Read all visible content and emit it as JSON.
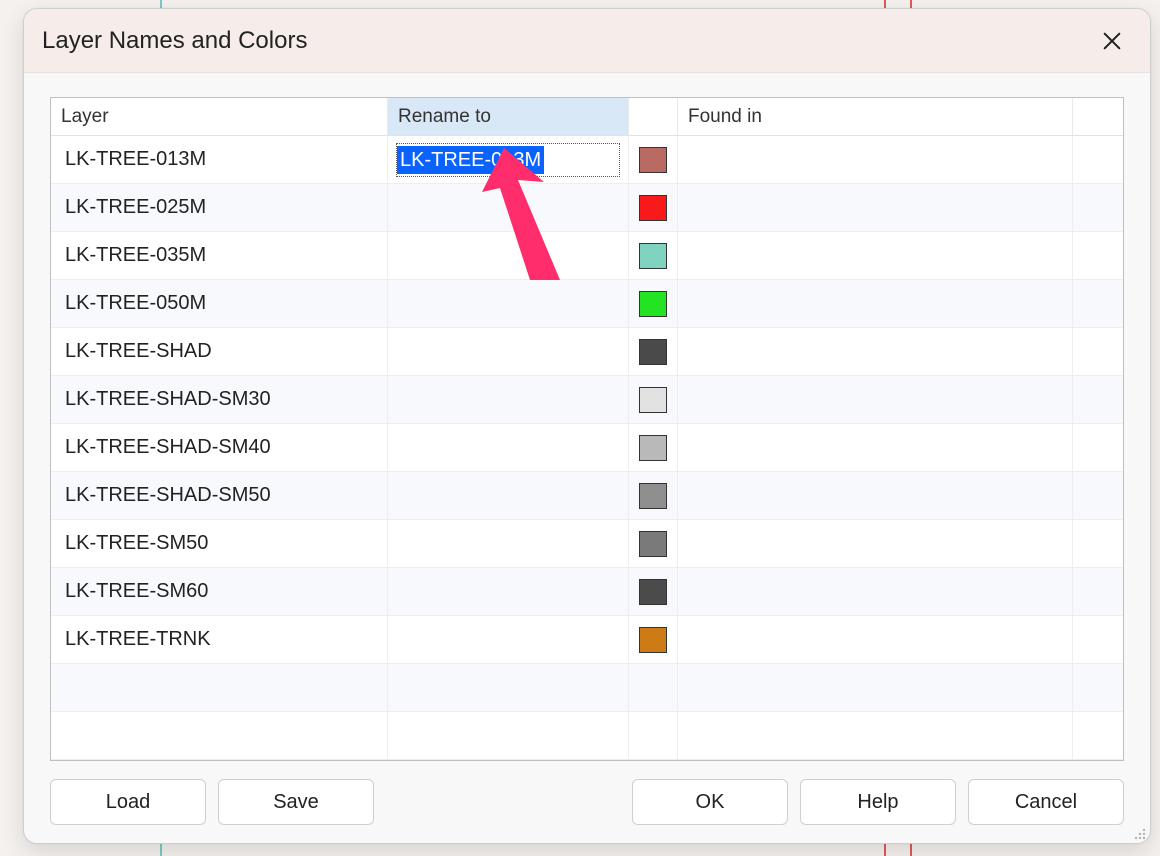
{
  "dialog": {
    "title": "Layer Names and Colors"
  },
  "columns": {
    "layer": "Layer",
    "rename": "Rename to",
    "found_in": "Found in"
  },
  "rows": [
    {
      "layer": "LK-TREE-013M",
      "rename": "LK-TREE-013M",
      "editing": true,
      "color": "#b96a62"
    },
    {
      "layer": "LK-TREE-025M",
      "rename": "",
      "editing": false,
      "color": "#f81a1a"
    },
    {
      "layer": "LK-TREE-035M",
      "rename": "",
      "editing": false,
      "color": "#7fd3bf"
    },
    {
      "layer": "LK-TREE-050M",
      "rename": "",
      "editing": false,
      "color": "#23e323"
    },
    {
      "layer": "LK-TREE-SHAD",
      "rename": "",
      "editing": false,
      "color": "#4a4a4a"
    },
    {
      "layer": "LK-TREE-SHAD-SM30",
      "rename": "",
      "editing": false,
      "color": "#e2e2e2"
    },
    {
      "layer": "LK-TREE-SHAD-SM40",
      "rename": "",
      "editing": false,
      "color": "#b9b9b9"
    },
    {
      "layer": "LK-TREE-SHAD-SM50",
      "rename": "",
      "editing": false,
      "color": "#8f8f8f"
    },
    {
      "layer": "LK-TREE-SM50",
      "rename": "",
      "editing": false,
      "color": "#7a7a7a"
    },
    {
      "layer": "LK-TREE-SM60",
      "rename": "",
      "editing": false,
      "color": "#4b4b4b"
    },
    {
      "layer": "LK-TREE-TRNK",
      "rename": "",
      "editing": false,
      "color": "#cd7b14"
    }
  ],
  "blank_rows": 2,
  "buttons": {
    "load": "Load",
    "save": "Save",
    "ok": "OK",
    "help": "Help",
    "cancel": "Cancel"
  },
  "annotation": {
    "arrow_color": "#ff2d6b"
  }
}
